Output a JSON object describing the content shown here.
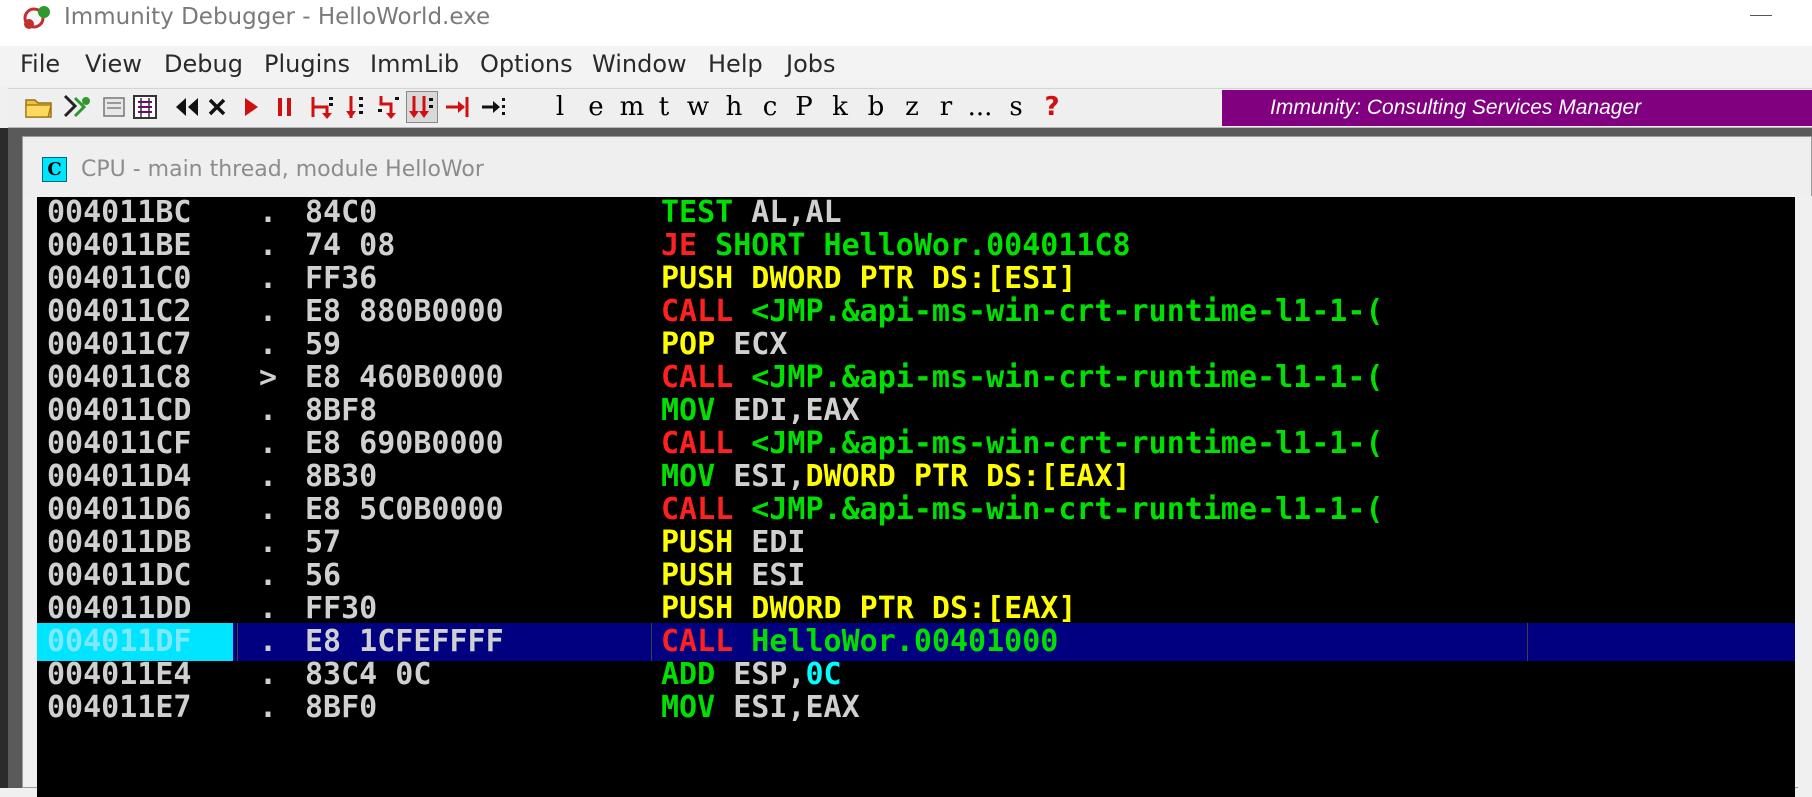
{
  "window": {
    "title": "Immunity Debugger - HelloWorld.exe"
  },
  "menu": [
    "File",
    "View",
    "Debug",
    "Plugins",
    "ImmLib",
    "Options",
    "Window",
    "Help",
    "Jobs"
  ],
  "toolbar": {
    "letters": [
      "l",
      "e",
      "m",
      "t",
      "w",
      "h",
      "c",
      "P",
      "k",
      "b",
      "z",
      "r",
      "...",
      "s",
      "?"
    ],
    "banner": "Immunity: Consulting Services Manager"
  },
  "cpu_window": {
    "icon_letter": "C",
    "title": "CPU - main thread, module HelloWor"
  },
  "colors": {
    "mnemonic_test_mov_add_pop": "#00e000",
    "mnemonic_call_je": "#ff2020",
    "mnemonic_push": "#ffff00",
    "operand_default": "#d0d0d0",
    "operand_target": "#00e000",
    "operand_memory": "#ffff00",
    "operand_immediate": "#00ffff",
    "selected_row_bg": "#000080",
    "banner_bg": "#800080"
  },
  "disassembly": [
    {
      "address": "004011BC",
      "marker": ".",
      "hex": "84C0",
      "instruction": [
        {
          "text": "TEST",
          "color": "#00e000"
        },
        {
          "text": " AL,AL",
          "color": "#d0d0d0"
        }
      ]
    },
    {
      "address": "004011BE",
      "marker": ".",
      "hex": "74 08",
      "instruction": [
        {
          "text": "JE",
          "color": "#ff2020"
        },
        {
          "text": " SHORT HelloWor.004011C8",
          "color": "#00e000"
        }
      ]
    },
    {
      "address": "004011C0",
      "marker": ".",
      "hex": "FF36",
      "instruction": [
        {
          "text": "PUSH",
          "color": "#ffff00"
        },
        {
          "text": " DWORD PTR DS:[ESI]",
          "color": "#ffff00"
        }
      ]
    },
    {
      "address": "004011C2",
      "marker": ".",
      "hex": "E8 880B0000",
      "instruction": [
        {
          "text": "CALL",
          "color": "#ff2020"
        },
        {
          "text": " <JMP.&api-ms-win-crt-runtime-l1-1-(",
          "color": "#00e000"
        }
      ]
    },
    {
      "address": "004011C7",
      "marker": ".",
      "hex": "59",
      "instruction": [
        {
          "text": "POP",
          "color": "#ffff00"
        },
        {
          "text": " ECX",
          "color": "#d0d0d0"
        }
      ]
    },
    {
      "address": "004011C8",
      "marker": ">",
      "hex": "E8 460B0000",
      "instruction": [
        {
          "text": "CALL",
          "color": "#ff2020"
        },
        {
          "text": " <JMP.&api-ms-win-crt-runtime-l1-1-(",
          "color": "#00e000"
        }
      ]
    },
    {
      "address": "004011CD",
      "marker": ".",
      "hex": "8BF8",
      "instruction": [
        {
          "text": "MOV",
          "color": "#00e000"
        },
        {
          "text": " EDI,EAX",
          "color": "#d0d0d0"
        }
      ]
    },
    {
      "address": "004011CF",
      "marker": ".",
      "hex": "E8 690B0000",
      "instruction": [
        {
          "text": "CALL",
          "color": "#ff2020"
        },
        {
          "text": " <JMP.&api-ms-win-crt-runtime-l1-1-(",
          "color": "#00e000"
        }
      ]
    },
    {
      "address": "004011D4",
      "marker": ".",
      "hex": "8B30",
      "instruction": [
        {
          "text": "MOV",
          "color": "#00e000"
        },
        {
          "text": " ESI,",
          "color": "#d0d0d0"
        },
        {
          "text": "DWORD PTR DS:[EAX]",
          "color": "#ffff00"
        }
      ]
    },
    {
      "address": "004011D6",
      "marker": ".",
      "hex": "E8 5C0B0000",
      "instruction": [
        {
          "text": "CALL",
          "color": "#ff2020"
        },
        {
          "text": " <JMP.&api-ms-win-crt-runtime-l1-1-(",
          "color": "#00e000"
        }
      ]
    },
    {
      "address": "004011DB",
      "marker": ".",
      "hex": "57",
      "instruction": [
        {
          "text": "PUSH",
          "color": "#ffff00"
        },
        {
          "text": " EDI",
          "color": "#d0d0d0"
        }
      ]
    },
    {
      "address": "004011DC",
      "marker": ".",
      "hex": "56",
      "instruction": [
        {
          "text": "PUSH",
          "color": "#ffff00"
        },
        {
          "text": " ESI",
          "color": "#d0d0d0"
        }
      ]
    },
    {
      "address": "004011DD",
      "marker": ".",
      "hex": "FF30",
      "instruction": [
        {
          "text": "PUSH",
          "color": "#ffff00"
        },
        {
          "text": " DWORD PTR DS:[EAX]",
          "color": "#ffff00"
        }
      ]
    },
    {
      "address": "004011DF",
      "marker": ".",
      "hex": "E8 1CFEFFFF",
      "selected": true,
      "instruction": [
        {
          "text": "CALL",
          "color": "#ff2020"
        },
        {
          "text": " HelloWor.00401000",
          "color": "#00e000"
        }
      ]
    },
    {
      "address": "004011E4",
      "marker": ".",
      "hex": "83C4 0C",
      "instruction": [
        {
          "text": "ADD",
          "color": "#00e000"
        },
        {
          "text": " ESP,",
          "color": "#d0d0d0"
        },
        {
          "text": "0C",
          "color": "#00ffff"
        }
      ]
    },
    {
      "address": "004011E7",
      "marker": ".",
      "hex": "8BF0",
      "instruction": [
        {
          "text": "MOV",
          "color": "#00e000"
        },
        {
          "text": " ESI,EAX",
          "color": "#d0d0d0"
        }
      ]
    }
  ]
}
